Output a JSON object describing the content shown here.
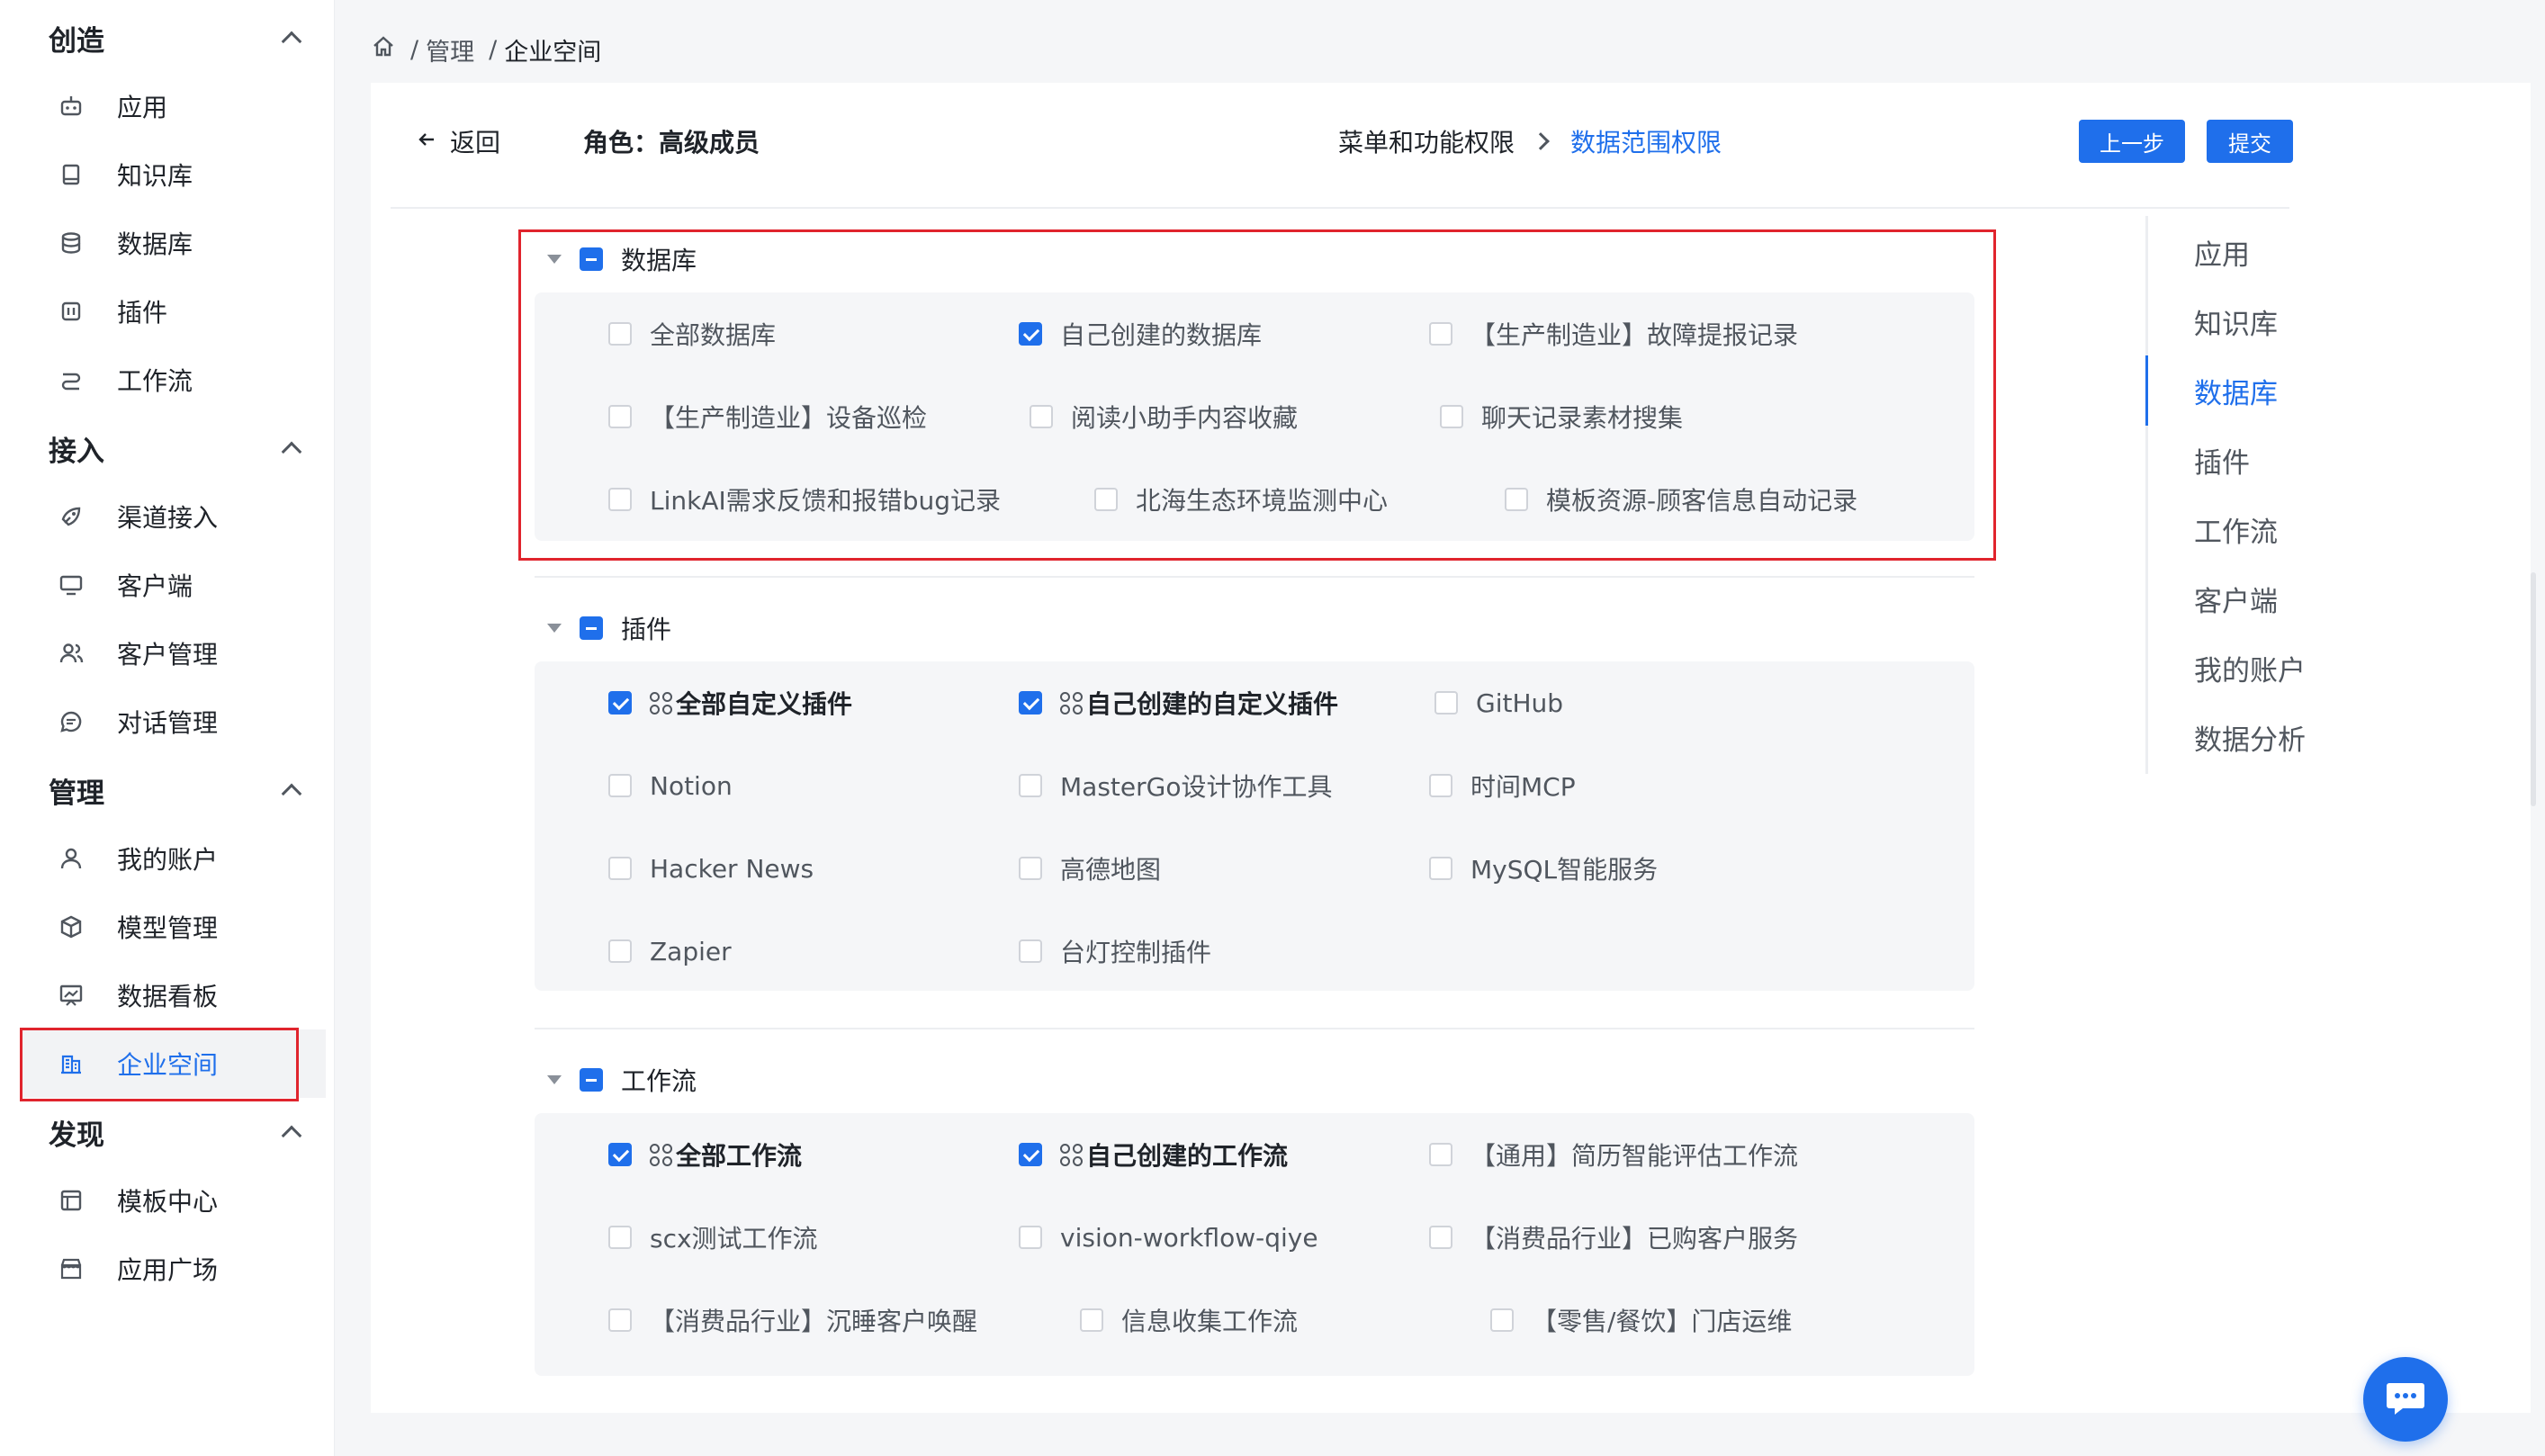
{
  "sidebar": {
    "groups": [
      {
        "title": "创造",
        "items": [
          {
            "label": "应用",
            "icon": "robot-icon"
          },
          {
            "label": "知识库",
            "icon": "book-icon"
          },
          {
            "label": "数据库",
            "icon": "database-icon"
          },
          {
            "label": "插件",
            "icon": "plugin-icon"
          },
          {
            "label": "工作流",
            "icon": "workflow-icon"
          }
        ]
      },
      {
        "title": "接入",
        "items": [
          {
            "label": "渠道接入",
            "icon": "rocket-icon"
          },
          {
            "label": "客户端",
            "icon": "monitor-icon"
          },
          {
            "label": "客户管理",
            "icon": "users-icon"
          },
          {
            "label": "对话管理",
            "icon": "chat-icon"
          }
        ]
      },
      {
        "title": "管理",
        "items": [
          {
            "label": "我的账户",
            "icon": "user-icon"
          },
          {
            "label": "模型管理",
            "icon": "cube-icon"
          },
          {
            "label": "数据看板",
            "icon": "dashboard-icon"
          },
          {
            "label": "企业空间",
            "icon": "building-icon",
            "active": true
          }
        ]
      },
      {
        "title": "发现",
        "items": [
          {
            "label": "模板中心",
            "icon": "template-icon"
          },
          {
            "label": "应用广场",
            "icon": "store-icon"
          }
        ]
      }
    ]
  },
  "breadcrumb": {
    "home_icon": "home-icon",
    "items": [
      "管理",
      "企业空间"
    ],
    "separator": "/"
  },
  "header": {
    "back_label": "返回",
    "role_label": "角色：高级成员",
    "step1": "菜单和功能权限",
    "step2": "数据范围权限",
    "prev_button": "上一步",
    "submit_button": "提交"
  },
  "sections": {
    "database": {
      "title": "数据库",
      "options": [
        {
          "label": "全部数据库",
          "checked": false
        },
        {
          "label": "自己创建的数据库",
          "checked": true
        },
        {
          "label": "【生产制造业】故障提报记录",
          "checked": false
        },
        {
          "label": "【生产制造业】设备巡检",
          "checked": false
        },
        {
          "label": "阅读小助手内容收藏",
          "checked": false
        },
        {
          "label": "聊天记录素材搜集",
          "checked": false
        },
        {
          "label": "LinkAI需求反馈和报错bug记录",
          "checked": false
        },
        {
          "label": "北海生态环境监测中心",
          "checked": false
        },
        {
          "label": "模板资源-顾客信息自动记录",
          "checked": false
        }
      ]
    },
    "plugin": {
      "title": "插件",
      "options": [
        {
          "label": "全部自定义插件",
          "checked": true,
          "bold": true,
          "icon": "grid-icon"
        },
        {
          "label": "自己创建的自定义插件",
          "checked": true,
          "bold": true,
          "icon": "grid-icon"
        },
        {
          "label": "GitHub",
          "checked": false
        },
        {
          "label": "Notion",
          "checked": false
        },
        {
          "label": "MasterGo设计协作工具",
          "checked": false
        },
        {
          "label": "时间MCP",
          "checked": false
        },
        {
          "label": "Hacker News",
          "checked": false
        },
        {
          "label": "高德地图",
          "checked": false
        },
        {
          "label": "MySQL智能服务",
          "checked": false
        },
        {
          "label": "Zapier",
          "checked": false
        },
        {
          "label": "台灯控制插件",
          "checked": false
        }
      ]
    },
    "workflow": {
      "title": "工作流",
      "options": [
        {
          "label": "全部工作流",
          "checked": true,
          "bold": true,
          "icon": "grid-icon"
        },
        {
          "label": "自己创建的工作流",
          "checked": true,
          "bold": true,
          "icon": "grid-icon"
        },
        {
          "label": "【通用】简历智能评估工作流",
          "checked": false
        },
        {
          "label": "scx测试工作流",
          "checked": false
        },
        {
          "label": "vision-workflow-qiye",
          "checked": false
        },
        {
          "label": "【消费品行业】已购客户服务",
          "checked": false
        },
        {
          "label": "【消费品行业】沉睡客户唤醒",
          "checked": false
        },
        {
          "label": "信息收集工作流",
          "checked": false
        },
        {
          "label": "【零售/餐饮】门店运维",
          "checked": false
        }
      ]
    }
  },
  "anchor_nav": {
    "items": [
      "应用",
      "知识库",
      "数据库",
      "插件",
      "工作流",
      "客户端",
      "我的账户",
      "数据分析"
    ],
    "active": "数据库"
  },
  "fab": {
    "icon": "chat-bubble-icon"
  },
  "colors": {
    "accent": "#1f6feb",
    "highlight": "#e0242d",
    "panel": "#f5f6f8"
  }
}
